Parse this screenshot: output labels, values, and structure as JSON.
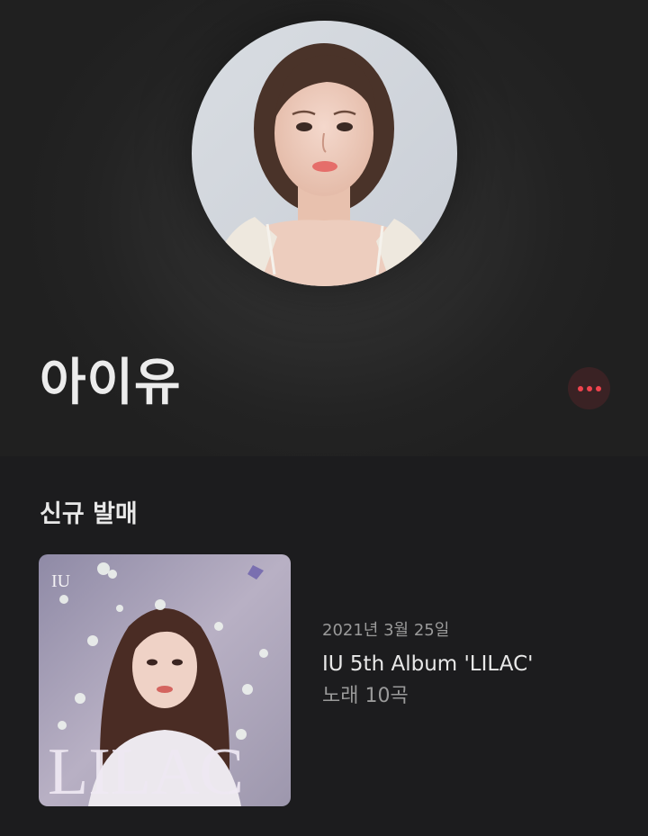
{
  "artist": {
    "name": "아이유",
    "avatar_icon": "artist-photo",
    "more_icon": "ellipsis-icon",
    "accent_color": "#f0434d"
  },
  "new_release": {
    "section_title": "신규 발매",
    "album": {
      "date": "2021년 3월 25일",
      "title": "IU 5th Album 'LILAC'",
      "tracks": "노래 10곡",
      "cover_logo": "IU",
      "cover_title": "LILAC"
    }
  }
}
